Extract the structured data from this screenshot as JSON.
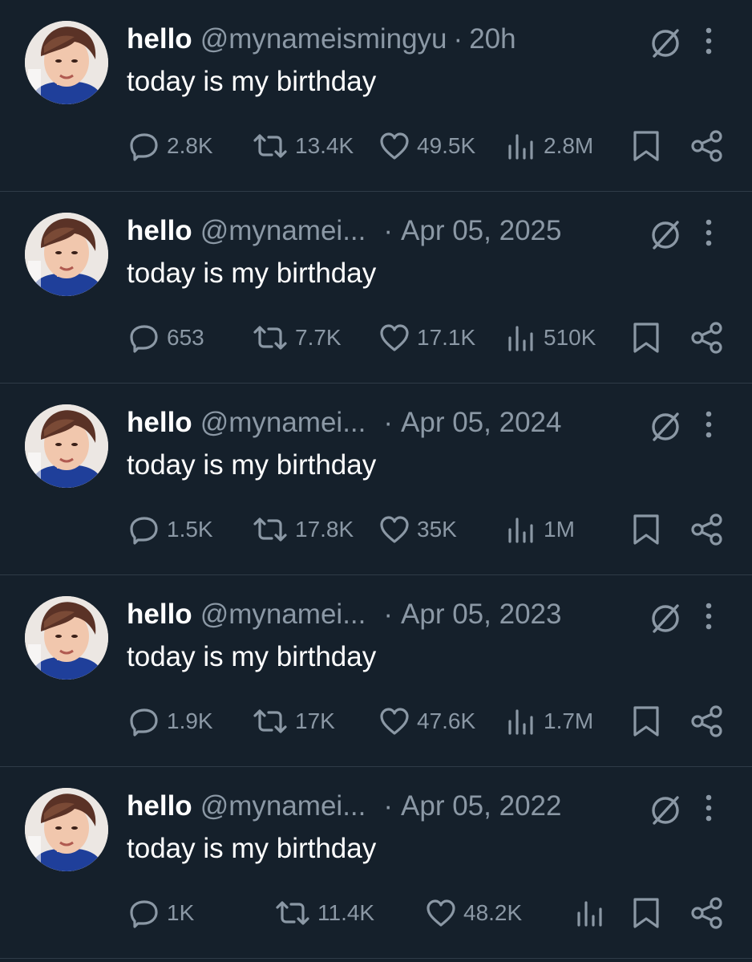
{
  "colors": {
    "background": "#15202b",
    "text_primary": "#ffffff",
    "text_secondary": "#8b98a5",
    "divider": "#2f3b47"
  },
  "icons": {
    "reply": "reply-icon",
    "retweet": "retweet-icon",
    "like": "like-icon",
    "views": "views-icon",
    "bookmark": "bookmark-icon",
    "share": "share-icon",
    "grok": "grok-icon",
    "more": "more-icon"
  },
  "tweets": [
    {
      "name": "hello",
      "handle": "@mynameismingyu",
      "separator": "·",
      "date": "20h",
      "text": "today is my birthday",
      "replies": "2.8K",
      "retweets": "13.4K",
      "likes": "49.5K",
      "views": "2.8M"
    },
    {
      "name": "hello",
      "handle": "@mynamei...",
      "separator": "·",
      "date": "Apr 05, 2025",
      "text": "today is my birthday",
      "replies": "653",
      "retweets": "7.7K",
      "likes": "17.1K",
      "views": "510K"
    },
    {
      "name": "hello",
      "handle": "@mynamei...",
      "separator": "·",
      "date": "Apr 05, 2024",
      "text": "today is my birthday",
      "replies": "1.5K",
      "retweets": "17.8K",
      "likes": "35K",
      "views": "1M"
    },
    {
      "name": "hello",
      "handle": "@mynamei...",
      "separator": "·",
      "date": "Apr 05, 2023",
      "text": "today is my birthday",
      "replies": "1.9K",
      "retweets": "17K",
      "likes": "47.6K",
      "views": "1.7M"
    },
    {
      "name": "hello",
      "handle": "@mynamei...",
      "separator": "·",
      "date": "Apr 05, 2022",
      "text": "today is my birthday",
      "replies": "1K",
      "retweets": "11.4K",
      "likes": "48.2K",
      "views": ""
    }
  ]
}
